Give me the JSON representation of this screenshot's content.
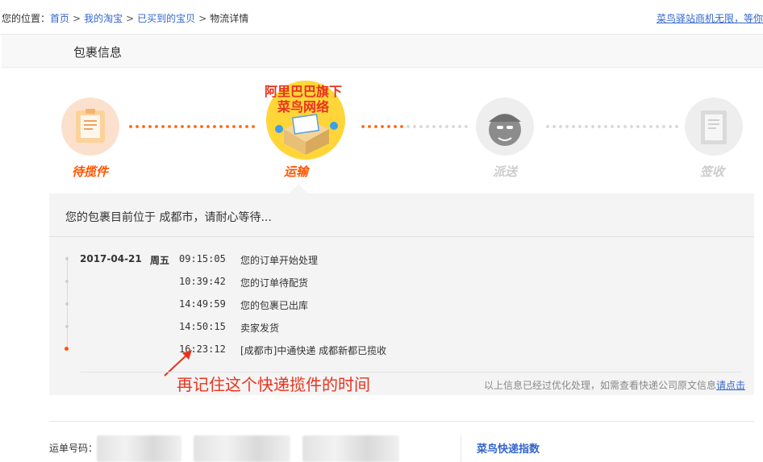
{
  "breadcrumb": {
    "prefix": "您的位置：",
    "items": [
      "首页",
      "我的淘宝",
      "已买到的宝贝"
    ],
    "current": "物流详情",
    "separator": ">"
  },
  "top_right_link": "菜鸟驿站商机无限，等你",
  "section_title": "包裹信息",
  "steps": [
    {
      "label": "待揽件",
      "state": "done",
      "icon": "package-doc-icon"
    },
    {
      "label": "运输",
      "state": "current",
      "icon": "cainiao-box-icon",
      "badge_line1": "阿里巴巴旗下",
      "badge_line2": "菜鸟网络"
    },
    {
      "label": "派送",
      "state": "pending",
      "icon": "courier-icon"
    },
    {
      "label": "签收",
      "state": "pending",
      "icon": "signed-doc-icon"
    }
  ],
  "status_message": "您的包裹目前位于 成都市，请耐心等待...",
  "tracking": {
    "date": "2017-04-21",
    "weekday": "周五",
    "events": [
      {
        "time": "09:15:05",
        "text": "您的订单开始处理"
      },
      {
        "time": "10:39:42",
        "text": "您的订单待配货"
      },
      {
        "time": "14:49:59",
        "text": "您的包裹已出库"
      },
      {
        "time": "14:50:15",
        "text": "卖家发货"
      },
      {
        "time": "16:23:12",
        "text": "[成都市]中通快递 成都新都已揽收"
      }
    ]
  },
  "annotation": "再记住这个快递揽件的时间",
  "note_text": "以上信息已经过优化处理，如需查看快递公司原文信息",
  "note_link": "请点击",
  "waybill_label": "运单号码：",
  "cainiao_index": "菜鸟快递指数",
  "colors": {
    "accent": "#ff5500",
    "active_label": "#ff5500",
    "inactive_label": "#cccccc",
    "link": "#3366cc",
    "annotation": "#e8331d"
  }
}
